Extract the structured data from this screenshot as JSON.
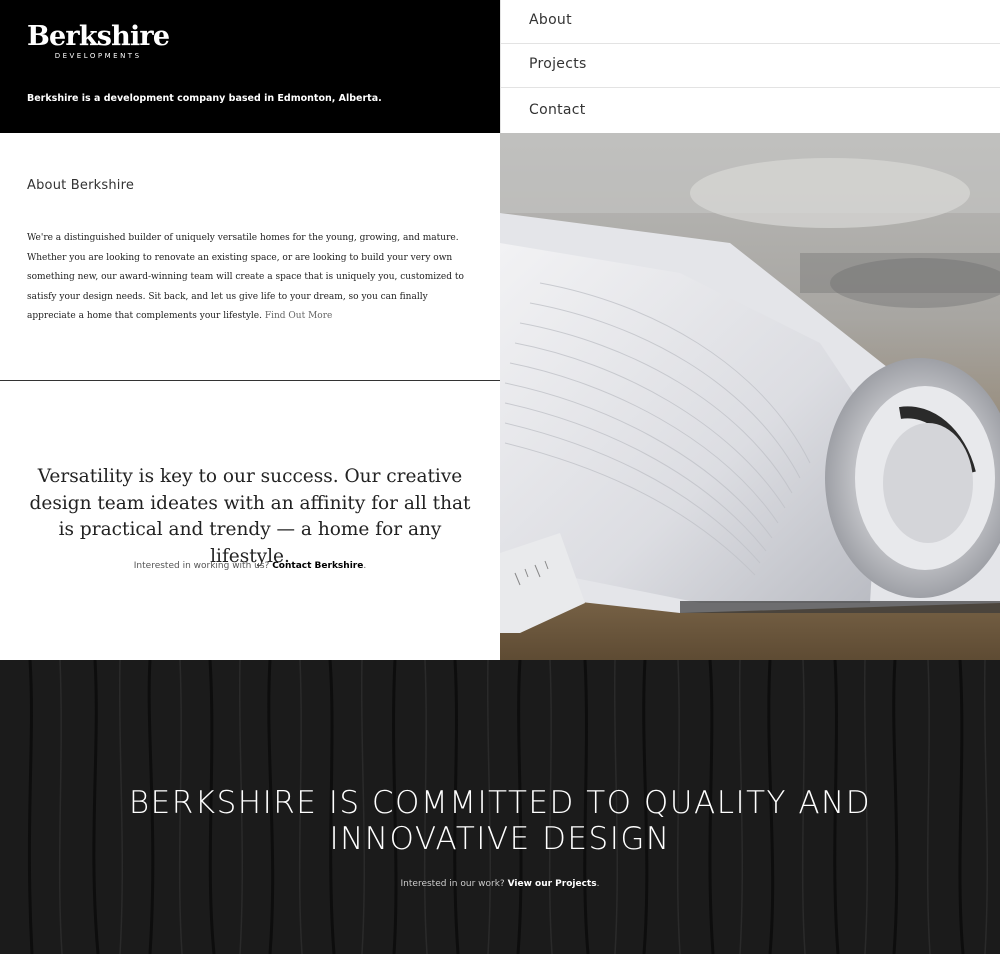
{
  "header": {
    "logo_main": "Berkshire",
    "logo_sub": "DEVELOPMENTS",
    "tagline": "Berkshire is a development company based in Edmonton, Alberta."
  },
  "nav": {
    "items": [
      {
        "label": "About"
      },
      {
        "label": "Projects"
      },
      {
        "label": "Contact"
      }
    ]
  },
  "about": {
    "title": "About Berkshire",
    "text": "We're a distinguished builder of uniquely versatile homes for the young, growing, and mature. Whether you are looking to renovate an existing space, or are looking to build your very own something new, our award-winning team will create a space that is uniquely you, customized to satisfy your design needs. Sit back, and let us give life to your dream, so you can finally appreciate a home that complements your lifestyle.",
    "link": "Find Out More"
  },
  "versatility": {
    "quote": "Versatility is key to our success. Our creative design team ideates with an affinity for all that is practical and trendy — a home for any lifestyle.",
    "interested_prefix": "Interested in working with us?",
    "contact_link": "Contact Berkshire",
    "suffix": "."
  },
  "bottom": {
    "headline": "BERKSHIRE IS COMMITTED TO QUALITY AND INNOVATIVE DESIGN",
    "sub_prefix": "Interested in our work?",
    "projects_link": "View our Projects",
    "suffix": "."
  },
  "colors": {
    "header_bg": "#000000",
    "footer_bg": "#1a1a1a",
    "text_dark": "#222222"
  }
}
